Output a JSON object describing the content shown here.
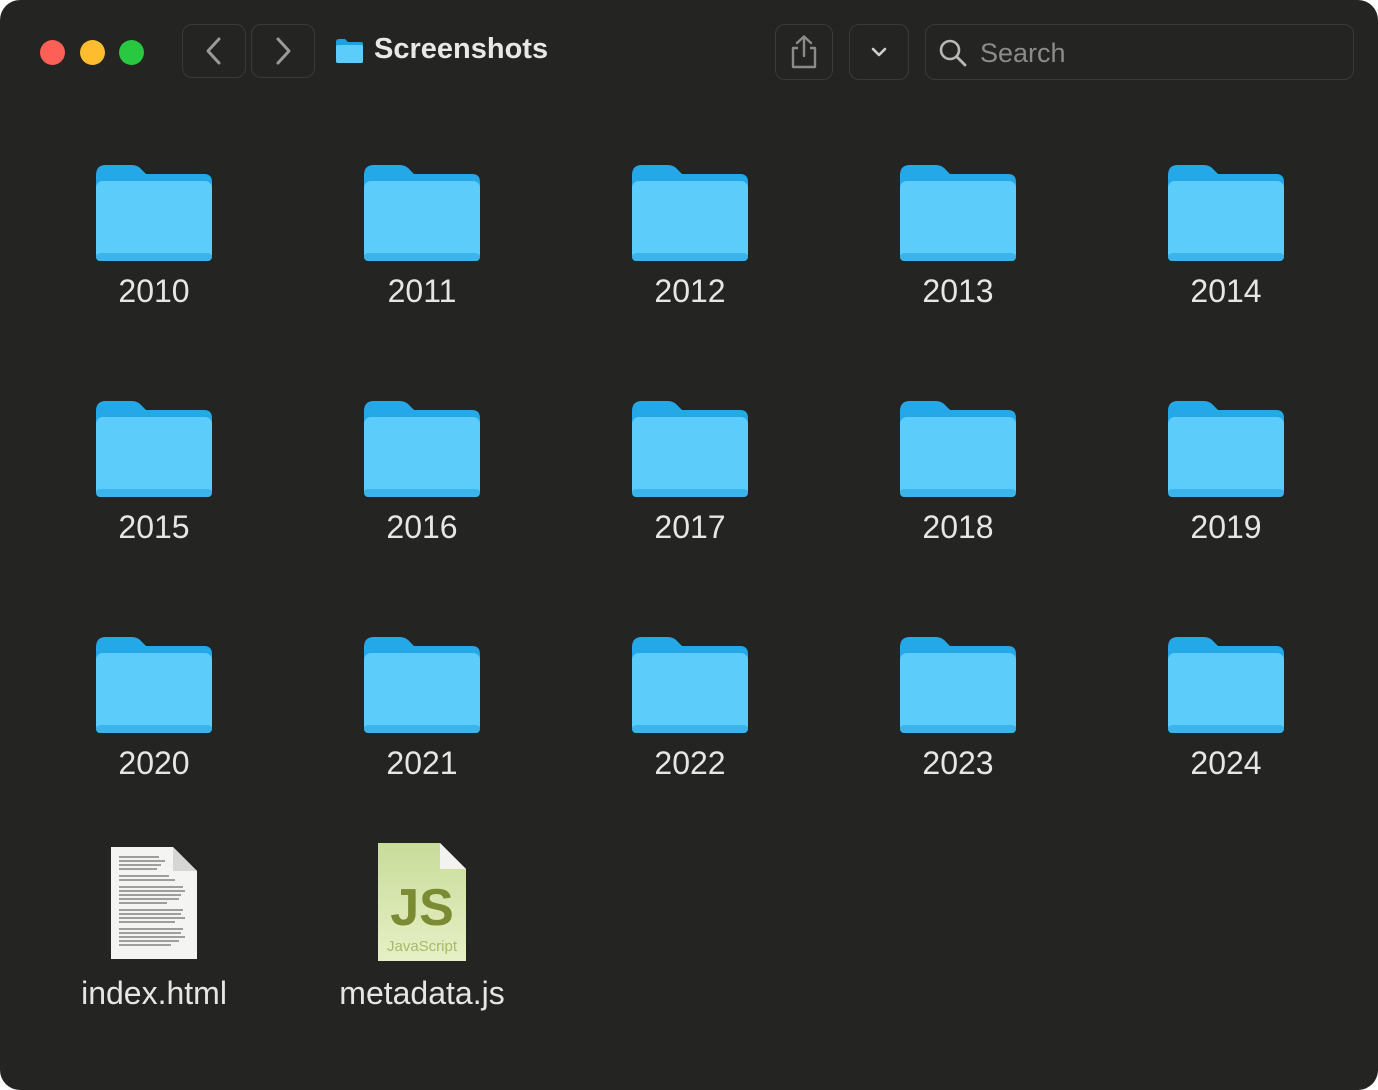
{
  "window": {
    "title": "Screenshots"
  },
  "toolbar": {
    "search_placeholder": "Search"
  },
  "items": [
    {
      "name": "2010",
      "kind": "folder"
    },
    {
      "name": "2011",
      "kind": "folder"
    },
    {
      "name": "2012",
      "kind": "folder"
    },
    {
      "name": "2013",
      "kind": "folder"
    },
    {
      "name": "2014",
      "kind": "folder"
    },
    {
      "name": "2015",
      "kind": "folder"
    },
    {
      "name": "2016",
      "kind": "folder"
    },
    {
      "name": "2017",
      "kind": "folder"
    },
    {
      "name": "2018",
      "kind": "folder"
    },
    {
      "name": "2019",
      "kind": "folder"
    },
    {
      "name": "2020",
      "kind": "folder"
    },
    {
      "name": "2021",
      "kind": "folder"
    },
    {
      "name": "2022",
      "kind": "folder"
    },
    {
      "name": "2023",
      "kind": "folder"
    },
    {
      "name": "2024",
      "kind": "folder"
    },
    {
      "name": "index.html",
      "kind": "html-file"
    },
    {
      "name": "metadata.js",
      "kind": "js-file",
      "badge": "JS",
      "badge_sub": "JavaScript"
    }
  ],
  "colors": {
    "background": "#242422",
    "folder_front": "#5ccdfb",
    "folder_back": "#25a8e8",
    "close": "#fe5f57",
    "minimize": "#febc2e",
    "zoom": "#28c840"
  }
}
